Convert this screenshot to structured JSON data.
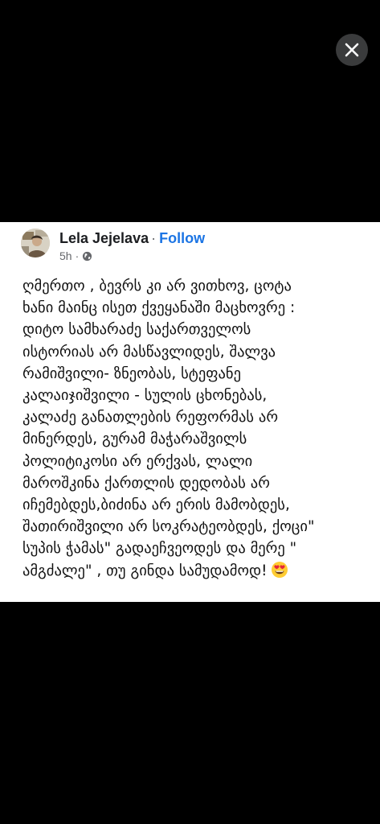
{
  "viewer": {
    "close_icon": "close-icon",
    "background": "#000000"
  },
  "post": {
    "author": "Lela Jejelava",
    "separator": "·",
    "follow_label": "Follow",
    "timestamp": "5h",
    "separator2": "·",
    "audience_icon": "globe-icon",
    "lines": [
      "ღმერთო , ბევრს კი არ ვითხოვ, ცოტა",
      "ხანი მაინც ისეთ ქვეყანაში მაცხოვრე  :",
      "დიტო სამხარაძე  საქართველოს",
      "ისტორიას არ მასწავლიდეს, შალვა",
      "რამიშვილი- ზნეობას, სტეფანე",
      "კალაიჯიშვილი - სულის ცხონებას,",
      "კალაძე განათლების რეფორმას არ",
      "მინერდეს, გურამ მაჭარაშვილს",
      "პოლიტიკოსი არ ერქვას, ლალი",
      "მაროშკინა ქართლის დედობას არ",
      "იჩემებდეს,ბიძინა არ ერის მამობდეს,",
      "შათირიშვილი არ სოკრატეობდეს, ქოცი\"",
      "სუპის ჭამას\" გადაეჩვეოდეს და მერე \"",
      "ამგძალე\" , თუ გინდა სამუდამოდ!"
    ],
    "emoji": "heart-eyes-emoji",
    "colors": {
      "follow": "#1b74e4",
      "author": "#1c1e21",
      "meta": "#65676b"
    }
  }
}
